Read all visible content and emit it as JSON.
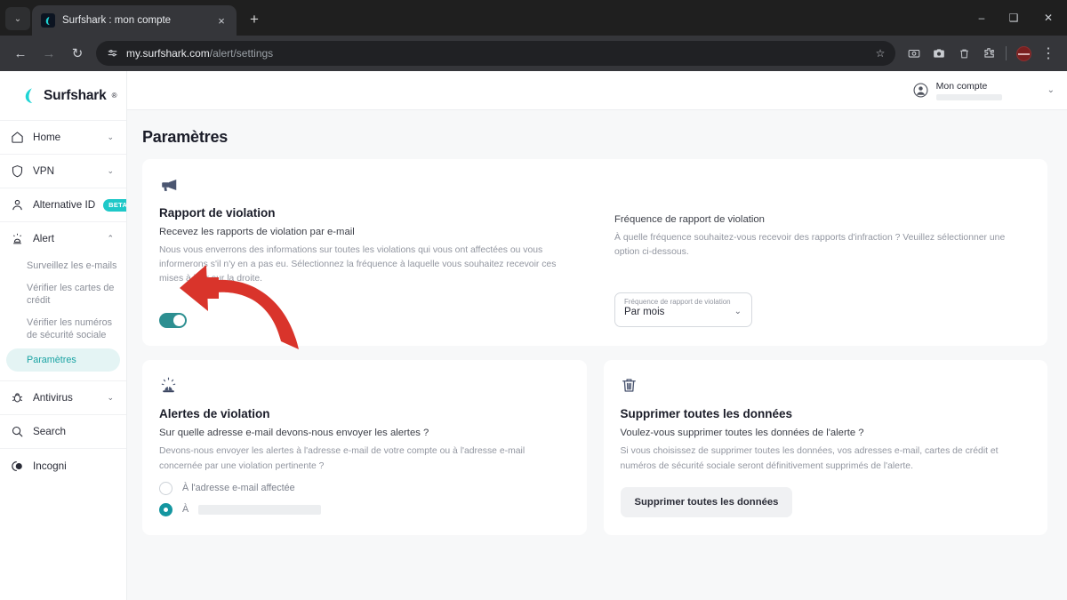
{
  "browser": {
    "tab": {
      "title": "Surfshark : mon compte",
      "favicon": "surfshark-logo-icon",
      "close": "×"
    },
    "newtab_label": "+",
    "tab_list_chevron": "⌄",
    "window_controls": {
      "minimize": "–",
      "restore": "❑",
      "close": "✕"
    },
    "nav": {
      "back": "←",
      "forward": "→",
      "reload": "↻"
    },
    "omnibox": {
      "site_settings_icon": "tune-icon",
      "url_host": "my.surfshark.com",
      "url_path": "/alert/settings",
      "star": "☆"
    },
    "toolbar_icons": [
      "screencast-icon",
      "camera-icon",
      "trash-icon",
      "extensions-puzzle-icon"
    ],
    "profile_avatar": "profile-avatar",
    "menu": "⋮"
  },
  "sidebar": {
    "brand": {
      "name": "Surfshark",
      "registered": "®"
    },
    "items": [
      {
        "label": "Home",
        "icon": "home-icon",
        "caret": "⌄",
        "badge": null
      },
      {
        "label": "VPN",
        "icon": "shield-icon",
        "caret": "⌄",
        "badge": null
      },
      {
        "label": "Alternative ID",
        "icon": "person-icon",
        "caret": null,
        "badge": "BETA"
      },
      {
        "label": "Alert",
        "icon": "siren-icon",
        "caret": "⌃",
        "badge": null
      },
      {
        "label": "Antivirus",
        "icon": "bug-icon",
        "caret": "⌄",
        "badge": null
      },
      {
        "label": "Search",
        "icon": "search-icon",
        "caret": null,
        "badge": null
      },
      {
        "label": "Incogni",
        "icon": "incogni-icon",
        "caret": null,
        "badge": null
      }
    ],
    "alert_subitems": [
      {
        "label": "Surveillez les e-mails",
        "active": false
      },
      {
        "label": "Vérifier les cartes de crédit",
        "active": false
      },
      {
        "label": "Vérifier les numéros de sécurité sociale",
        "active": false
      },
      {
        "label": "Paramètres",
        "active": true
      }
    ]
  },
  "topbar": {
    "account_label": "Mon compte",
    "account_icon": "account-circle-icon",
    "caret": "⌄"
  },
  "page": {
    "title": "Paramètres"
  },
  "breach_report_card": {
    "icon": "megaphone-icon",
    "title": "Rapport de violation",
    "subtitle": "Recevez les rapports de violation par e-mail",
    "description": "Nous vous enverrons des informations sur toutes les violations qui vous ont affectées ou vous informerons s'il n'y en a pas eu. Sélectionnez la fréquence à laquelle vous souhaitez recevoir ces mises à jour sur la droite.",
    "toggle_state": "on",
    "frequency_title": "Fréquence de rapport de violation",
    "frequency_description": "À quelle fréquence souhaitez-vous recevoir des rapports d'infraction ? Veuillez sélectionner une option ci-dessous.",
    "select_label": "Fréquence de rapport de violation",
    "select_value": "Par mois",
    "select_caret": "⌄"
  },
  "breach_alerts_card": {
    "icon": "siren-icon",
    "title": "Alertes de violation",
    "subtitle": "Sur quelle adresse e-mail devons-nous envoyer les alertes ?",
    "description": "Devons-nous envoyer les alertes à l'adresse e-mail de votre compte ou à l'adresse e-mail concernée par une violation pertinente ?",
    "options": [
      {
        "label": "À l'adresse e-mail affectée",
        "selected": false,
        "redacted": false
      },
      {
        "label": "À",
        "selected": true,
        "redacted": true
      }
    ]
  },
  "delete_data_card": {
    "icon": "trash-icon",
    "title": "Supprimer toutes les données",
    "subtitle": "Voulez-vous supprimer toutes les données de l'alerte ?",
    "description": "Si vous choisissez de supprimer toutes les données, vos adresses e-mail, cartes de crédit et numéros de sécurité sociale seront définitivement supprimés de l'alerte.",
    "button_label": "Supprimer toutes les données"
  },
  "annotation": {
    "type": "curved-arrow",
    "color": "#d32f2f",
    "points_to": "breach-report-toggle"
  },
  "colors": {
    "accent_teal": "#1aa3a3",
    "toggle_on": "#2d8f91",
    "radio_selected": "#1496a0",
    "badge_beta": "#1ec8c8",
    "annotation_red": "#d32f2f",
    "page_bg": "#f7f8f9"
  }
}
